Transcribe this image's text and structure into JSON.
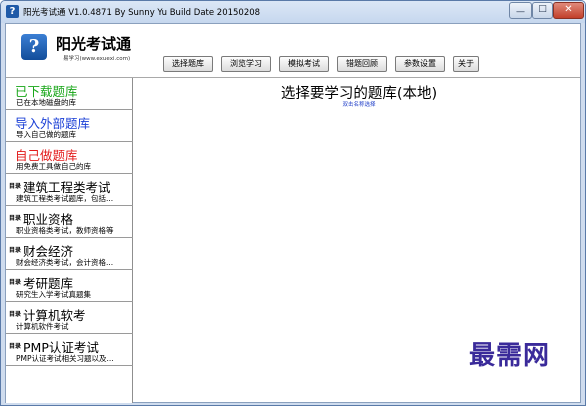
{
  "window": {
    "title": "阳光考试通 V1.0.4871 By Sunny Yu  Build Date 20150208",
    "controls": {
      "minimize": "—",
      "maximize": "□",
      "close": "✕"
    }
  },
  "header": {
    "logo_glyph": "?",
    "app_name": "阳光考试通",
    "app_sub": "易学习(www.exuexi.com)"
  },
  "toolbar": {
    "buttons": [
      "选择题库",
      "浏览学习",
      "模拟考试",
      "错题回顾",
      "参数设置",
      "关于"
    ]
  },
  "sidebar": {
    "dir_tag": "目录",
    "items": [
      {
        "title": "已下载题库",
        "desc": "已在本地磁盘的库",
        "color": "#18a618"
      },
      {
        "title": "导入外部题库",
        "desc": "导入自己做的题库",
        "color": "#1a3fd6"
      },
      {
        "title": "自己做题库",
        "desc": "用免费工具做自己的库",
        "color": "#e31b1b"
      },
      {
        "title": "建筑工程类考试",
        "desc": "建筑工程类考试题库，包括..."
      },
      {
        "title": "职业资格",
        "desc": "职业资格类考试，教师资格等"
      },
      {
        "title": "财会经济",
        "desc": "财会经济类考试，会计资格..."
      },
      {
        "title": "考研题库",
        "desc": "研究生入学考试真题集"
      },
      {
        "title": "计算机软考",
        "desc": "计算机软件考试"
      },
      {
        "title": "PMP认证考试",
        "desc": "PMP认证考试相关习题以及..."
      }
    ]
  },
  "main": {
    "title": "选择要学习的题库(本地)",
    "hint": "双击名称选择"
  },
  "watermark": "最需网"
}
